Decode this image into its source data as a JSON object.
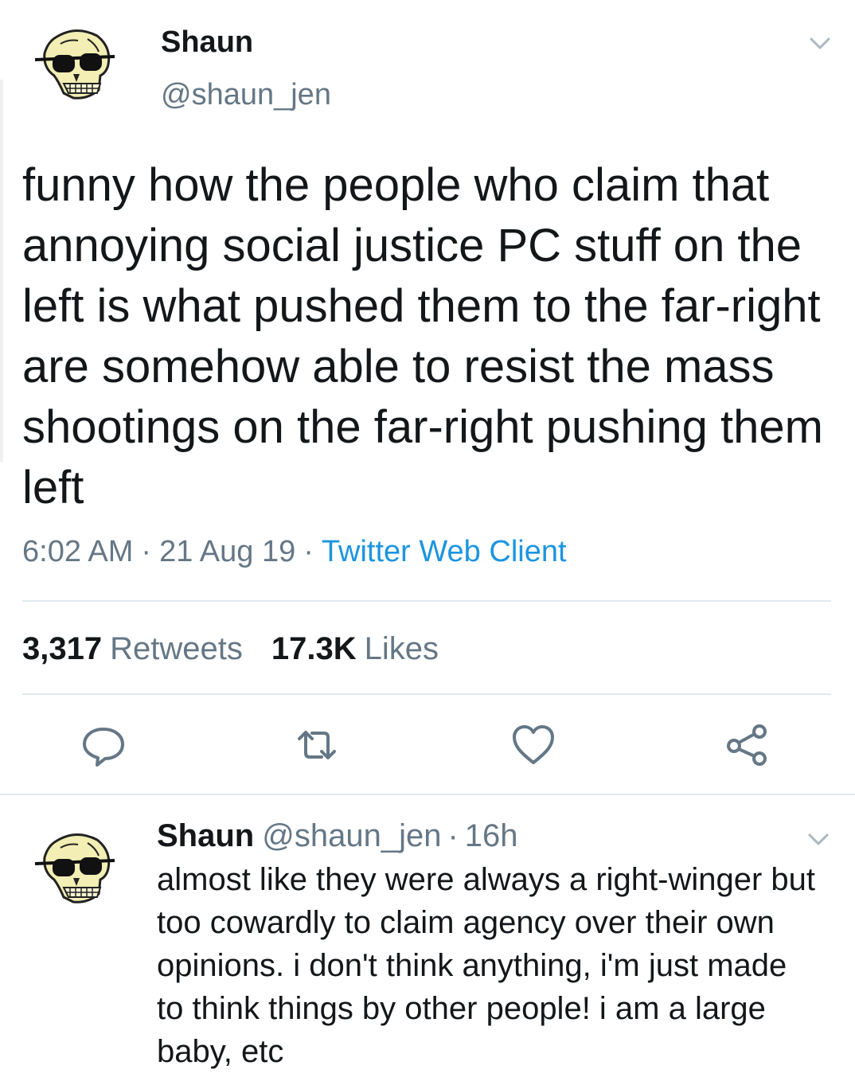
{
  "tweet": {
    "display_name": "Shaun",
    "handle": "@shaun_jen",
    "text": "funny how the people who claim that annoying social justice PC stuff on the left is what pushed them to the far-right are somehow able to resist the mass shootings on the far-right pushing them left",
    "time": "6:02 AM",
    "date": "21 Aug 19",
    "separator": "·",
    "client": "Twitter Web Client",
    "retweets_count": "3,317",
    "retweets_label": "Retweets",
    "likes_count": "17.3K",
    "likes_label": "Likes",
    "avatar_icon": "skull-with-sunglasses-icon",
    "caret_icon": "chevron-down-icon"
  },
  "actions": [
    {
      "name": "reply",
      "icon": "speech-bubble-icon"
    },
    {
      "name": "retweet",
      "icon": "retweet-icon"
    },
    {
      "name": "like",
      "icon": "heart-icon"
    },
    {
      "name": "share",
      "icon": "share-icon"
    }
  ],
  "reply": {
    "display_name": "Shaun",
    "handle": "@shaun_jen",
    "separator": "·",
    "time": "16h",
    "text": "almost like they were always a right-winger but too cowardly to claim agency over their own opinions. i don't think anything, i'm just made to think things by other people! i am a large baby, etc",
    "avatar_icon": "skull-with-sunglasses-icon"
  },
  "colors": {
    "text": "#14171a",
    "secondary": "#657786",
    "link": "#1b95e0",
    "divider": "#e1e8ed",
    "skull": "#f2eeb4"
  }
}
